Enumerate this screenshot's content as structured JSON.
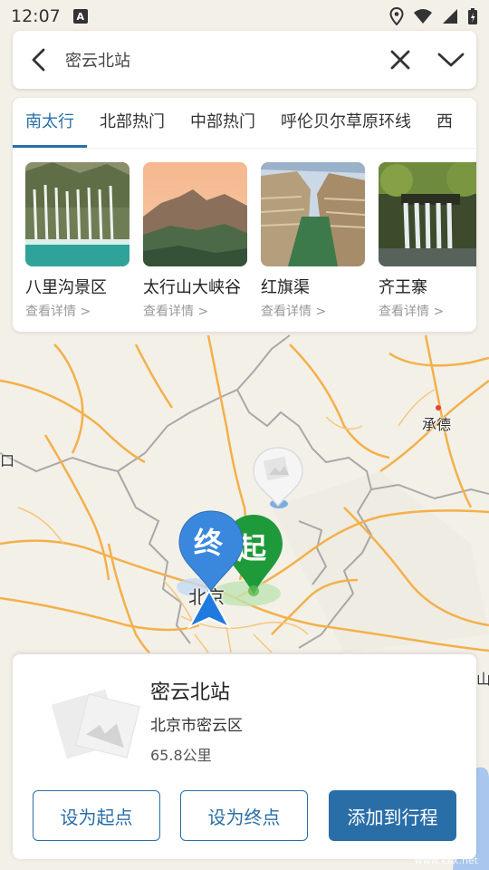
{
  "status_bar": {
    "time": "12:07",
    "notification_icon": "A",
    "icons": [
      "location-icon",
      "wifi-icon",
      "signal-icon",
      "battery-icon"
    ]
  },
  "search": {
    "query": "密云北站",
    "icons": [
      "back-arrow-icon",
      "close-icon",
      "chevron-down-icon"
    ]
  },
  "category_tabs": [
    {
      "label": "南太行",
      "active": true
    },
    {
      "label": "北部热门",
      "active": false
    },
    {
      "label": "中部热门",
      "active": false
    },
    {
      "label": "呼伦贝尔草原环线",
      "active": false
    },
    {
      "label": "西",
      "active": false
    }
  ],
  "attractions": [
    {
      "name": "八里沟景区",
      "more": "查看详情 >"
    },
    {
      "name": "太行山大峡谷",
      "more": "查看详情 >"
    },
    {
      "name": "红旗渠",
      "more": "查看详情 >"
    },
    {
      "name": "齐王寨",
      "more": "查看详情 >"
    }
  ],
  "map": {
    "labels": {
      "chengde": "承德",
      "beijing": "北京",
      "left_edge": "口",
      "right_edge": "山"
    },
    "pins": {
      "start": "起",
      "end": "终"
    }
  },
  "place": {
    "name": "密云北站",
    "address": "北京市密云区",
    "distance": "65.8公里"
  },
  "actions": {
    "set_start": "设为起点",
    "set_end": "设为终点",
    "add_trip": "添加到行程"
  },
  "watermark": "www.kkx.net",
  "colors": {
    "accent": "#2a6ea8",
    "start_pin": "#1f9a3a",
    "end_pin": "#3a88dd",
    "road_major": "#f4b04a",
    "boundary": "#a8a8a8"
  }
}
